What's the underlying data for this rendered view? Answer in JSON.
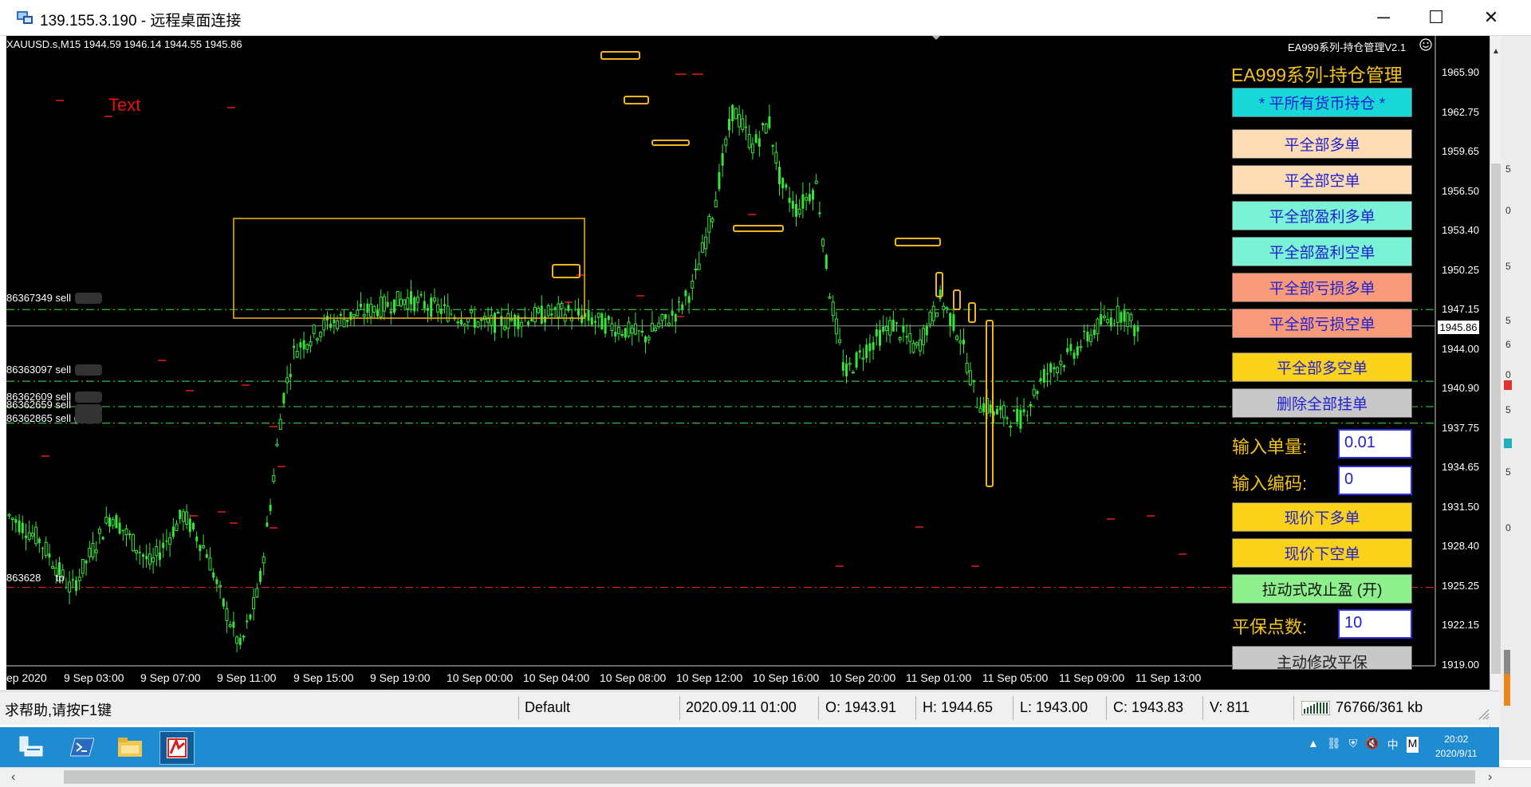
{
  "window": {
    "title": "139.155.3.190 - 远程桌面连接",
    "minimize_label": "─",
    "maximize_label": "☐",
    "close_label": "✕"
  },
  "chart": {
    "symbol_line": "XAUUSD.s,M15  1944.59 1946.14 1944.55 1945.86",
    "ea_tag": "EA999系列-持仓管理V2.1",
    "text_object": "Text",
    "current_price": "1945.86",
    "price_labels": [
      "1965.90",
      "1962.75",
      "1959.65",
      "1956.50",
      "1953.40",
      "1950.25",
      "1947.15",
      "1944.00",
      "1940.90",
      "1937.75",
      "1934.65",
      "1931.50",
      "1928.40",
      "1925.25",
      "1922.15",
      "1919.00"
    ],
    "time_labels": [
      "ep 2020",
      "9 Sep 03:00",
      "9 Sep 07:00",
      "9 Sep 11:00",
      "9 Sep 15:00",
      "9 Sep 19:00",
      "10 Sep 00:00",
      "10 Sep 04:00",
      "10 Sep 08:00",
      "10 Sep 12:00",
      "10 Sep 16:00",
      "10 Sep 20:00",
      "11 Sep 01:00",
      "11 Sep 05:00",
      "11 Sep 09:00",
      "11 Sep 13:00"
    ],
    "order_labels": [
      "86367349 sell",
      "86363097 sell",
      "86362609 sell",
      "86362659 sell",
      "86362865 sell (",
      "863628",
      "tp"
    ],
    "colors": {
      "bull": "#37e43a",
      "bear": "#37e43a",
      "box": "#f3b51c",
      "grid_line": "#2fbf2f",
      "tp_line": "#e01e1e"
    }
  },
  "panel": {
    "title": "EA999系列-持仓管理",
    "buttons": [
      {
        "label": "* 平所有货币持仓 *",
        "bg": "#18d7d7"
      },
      {
        "label": "平全部多单",
        "bg": "#fcdcb4"
      },
      {
        "label": "平全部空单",
        "bg": "#fcdcb4"
      },
      {
        "label": "平全部盈利多单",
        "bg": "#7af2d6"
      },
      {
        "label": "平全部盈利空单",
        "bg": "#7af2d6"
      },
      {
        "label": "平全部亏损多单",
        "bg": "#f99a7b"
      },
      {
        "label": "平全部亏损空单",
        "bg": "#f99a7b"
      },
      {
        "label": "平全部多空单",
        "bg": "#fbd21a"
      },
      {
        "label": "删除全部挂单",
        "bg": "#c8c8c8"
      }
    ],
    "lot_label": "输入单量:",
    "lot_value": "0.01",
    "code_label": "输入编码:",
    "code_value": "0",
    "buy_label": "现价下多单",
    "sell_label": "现价下空单",
    "trail_label": "拉动式改止盈 (开)",
    "breakeven_label": "平保点数:",
    "breakeven_value": "10",
    "modify_label": "主动修改平保"
  },
  "status": {
    "help": "求帮助,请按F1键",
    "profile": "Default",
    "datetime": "2020.09.11 01:00",
    "open": "O: 1943.91",
    "high": "H: 1944.65",
    "low": "L: 1943.00",
    "close": "C: 1943.83",
    "volume": "V: 811",
    "traffic": "76766/361 kb"
  },
  "taskbar": {
    "time": "20:02",
    "date": "2020/9/11",
    "ime": "中",
    "ime2": "M"
  }
}
